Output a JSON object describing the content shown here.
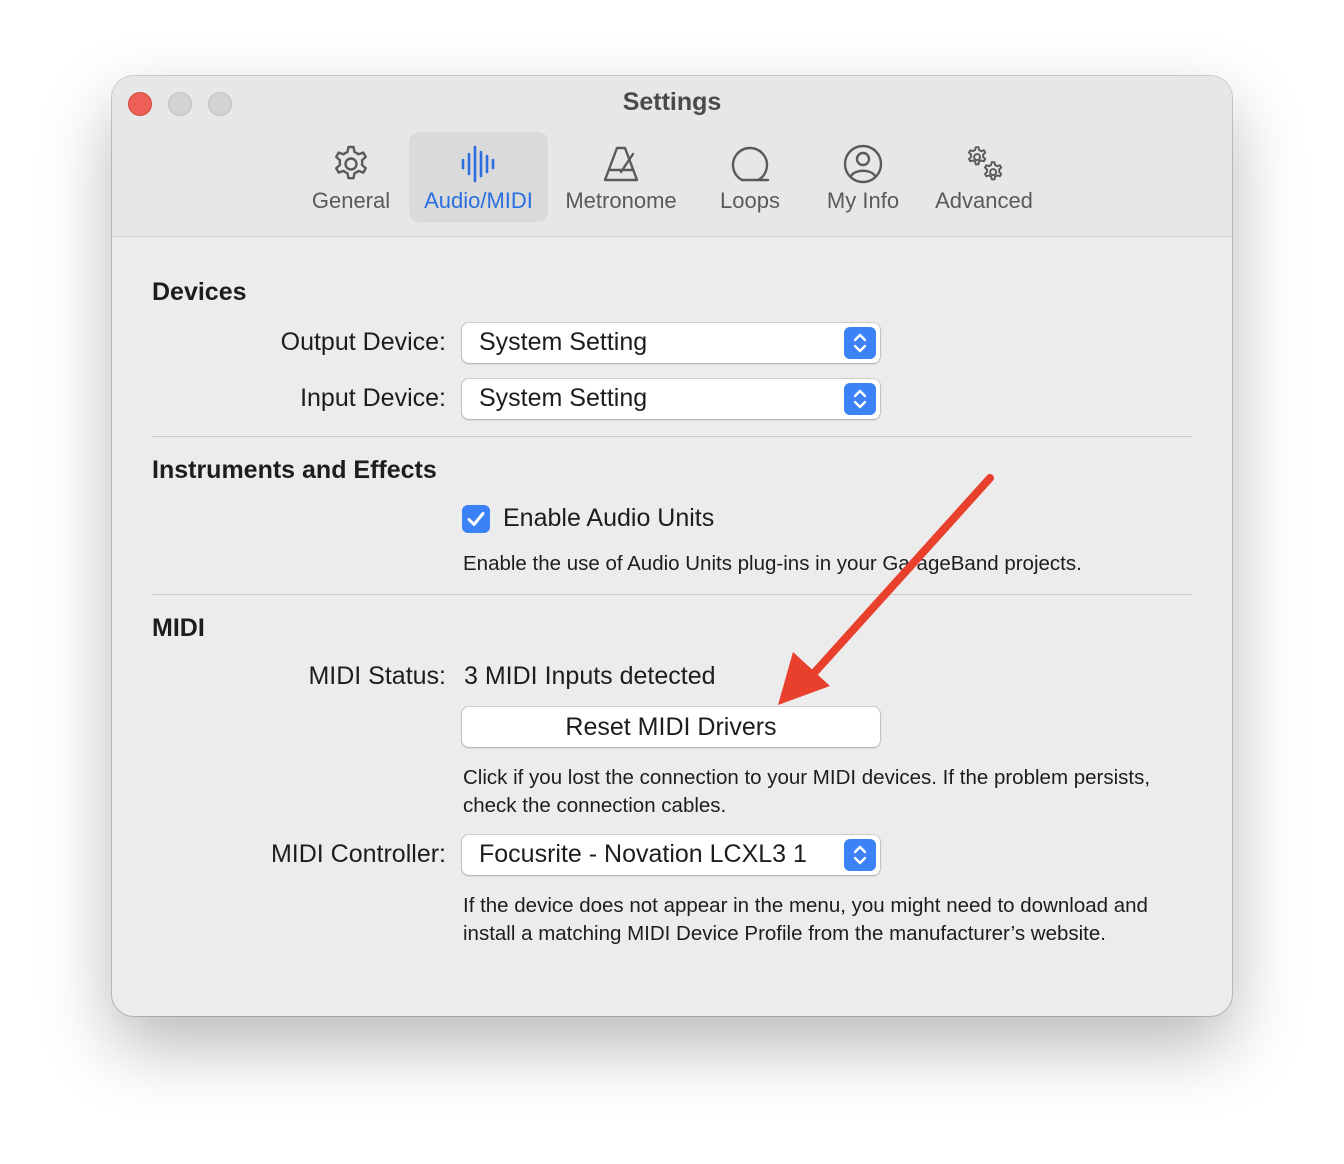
{
  "window": {
    "title": "Settings"
  },
  "toolbar": {
    "tabs": [
      {
        "label": "General",
        "icon": "gear-icon"
      },
      {
        "label": "Audio/MIDI",
        "icon": "waveform-icon",
        "active": true
      },
      {
        "label": "Metronome",
        "icon": "metronome-icon"
      },
      {
        "label": "Loops",
        "icon": "loop-icon"
      },
      {
        "label": "My Info",
        "icon": "person-circle-icon"
      },
      {
        "label": "Advanced",
        "icon": "gears-icon"
      }
    ]
  },
  "devices": {
    "title": "Devices",
    "output_label": "Output Device:",
    "output_value": "System Setting",
    "input_label": "Input Device:",
    "input_value": "System Setting"
  },
  "instruments": {
    "title": "Instruments and Effects",
    "enable_audio_units_label": "Enable Audio Units",
    "enable_audio_units_checked": true,
    "help": "Enable the use of Audio Units plug-ins in your GarageBand projects."
  },
  "midi": {
    "title": "MIDI",
    "status_label": "MIDI Status:",
    "status_value": "3 MIDI Inputs detected",
    "reset_button": "Reset MIDI Drivers",
    "reset_help": "Click if you lost the connection to your MIDI devices. If the problem persists, check the connection cables.",
    "controller_label": "MIDI Controller:",
    "controller_value": "Focusrite - Novation LCXL3 1",
    "controller_help": "If the device does not appear in the menu, you might need to download and install a matching MIDI Device Profile from the manufacturer’s website."
  },
  "colors": {
    "accent": "#3b82f6",
    "active_tab_text": "#2a6fe0",
    "annotation_arrow": "#e8402c",
    "close_button": "#ee5f57"
  }
}
